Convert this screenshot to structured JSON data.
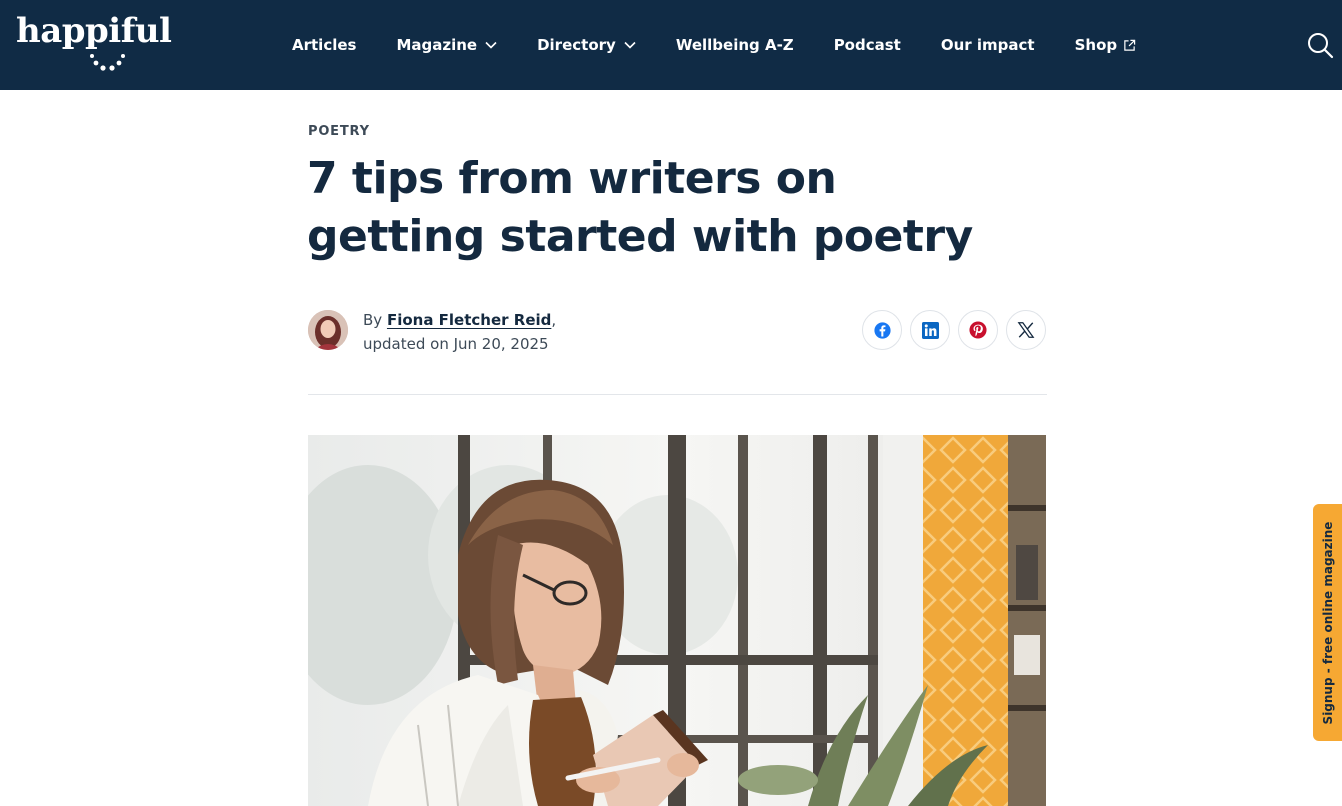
{
  "header": {
    "logo_text": "happiful",
    "nav": [
      {
        "label": "Articles"
      },
      {
        "label": "Magazine",
        "has_dropdown": true
      },
      {
        "label": "Directory",
        "has_dropdown": true
      },
      {
        "label": "Wellbeing A-Z"
      },
      {
        "label": "Podcast"
      },
      {
        "label": "Our impact"
      },
      {
        "label": "Shop",
        "external": true
      }
    ],
    "search_icon": "search-icon",
    "background_color": "#102b45"
  },
  "article": {
    "category": "POETRY",
    "title": "7 tips from writers on getting started with poetry",
    "byline_prefix": "By",
    "author": "Fiona Fletcher Reid",
    "byline_suffix": ",",
    "updated": "updated on Jun 20, 2025",
    "share_icons": [
      "facebook-icon",
      "linkedin-icon",
      "pinterest-icon",
      "x-icon"
    ]
  },
  "signup_tab": {
    "label": "Signup - free online magazine",
    "color": "#f6a833"
  }
}
